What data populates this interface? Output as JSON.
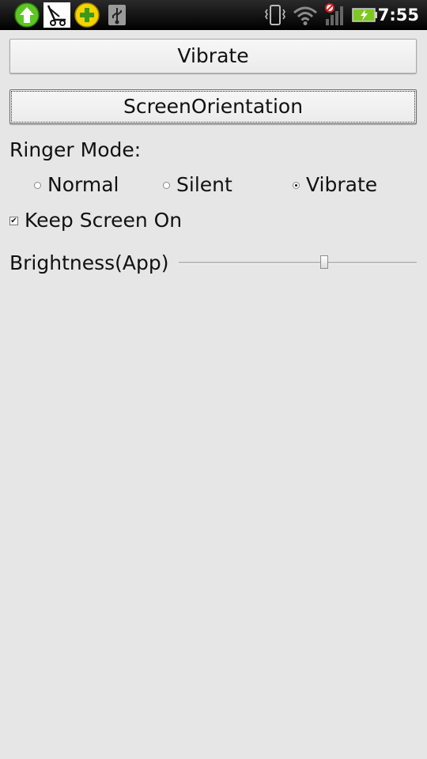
{
  "status_bar": {
    "time": "7:55",
    "notification_icons": [
      "upload-arrow-icon",
      "beach-chair-app-icon",
      "plus-badge-icon",
      "usb-icon"
    ],
    "system_icons": [
      "vibrate-mode-icon",
      "wifi-icon",
      "no-signal-icon",
      "battery-charging-icon"
    ],
    "colors": {
      "battery": "#7ec820",
      "upload_icon": "#5cc623",
      "plus_icon": "#f6d300"
    }
  },
  "buttons": {
    "vibrate_label": "Vibrate",
    "screen_orientation_label": "ScreenOrientation"
  },
  "ringer": {
    "label": "Ringer Mode:",
    "options": [
      {
        "label": "Normal",
        "selected": false
      },
      {
        "label": "Silent",
        "selected": false
      },
      {
        "label": "Vibrate",
        "selected": true
      }
    ]
  },
  "keep_screen_on": {
    "label": "Keep Screen On",
    "checked": true
  },
  "brightness": {
    "label": "Brightness(App)",
    "value_fraction": 0.61
  }
}
